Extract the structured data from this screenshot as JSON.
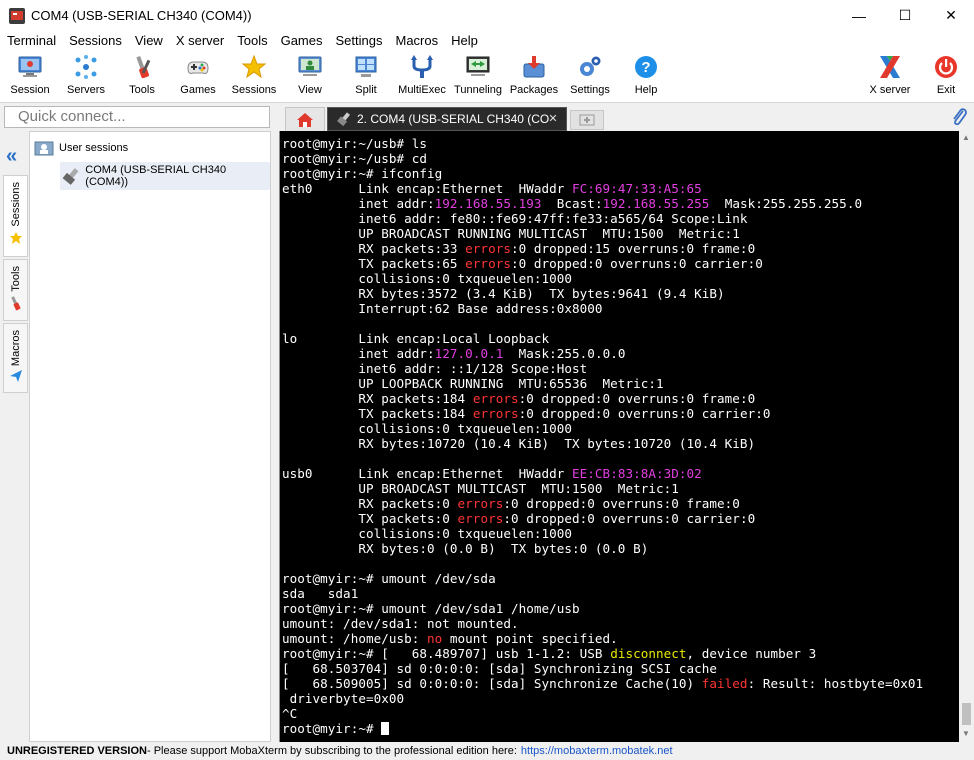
{
  "window": {
    "title": "COM4  (USB-SERIAL CH340 (COM4))",
    "controls": {
      "minimize": "—",
      "maximize": "☐",
      "close": "✕"
    }
  },
  "menu": [
    "Terminal",
    "Sessions",
    "View",
    "X server",
    "Tools",
    "Games",
    "Settings",
    "Macros",
    "Help"
  ],
  "toolbar": {
    "session": "Session",
    "servers": "Servers",
    "tools": "Tools",
    "games": "Games",
    "sessions": "Sessions",
    "view": "View",
    "split": "Split",
    "multiexec": "MultiExec",
    "tunneling": "Tunneling",
    "packages": "Packages",
    "settings": "Settings",
    "help": "Help",
    "xserver": "X server",
    "exit": "Exit"
  },
  "quick_connect": {
    "placeholder": "Quick connect..."
  },
  "tabs": {
    "active_label": "2. COM4  (USB-SERIAL CH340 (CO",
    "close_glyph": "✕"
  },
  "rail": {
    "sessions": "Sessions",
    "tools": "Tools",
    "macros": "Macros"
  },
  "sessions_tree": {
    "root": "User sessions",
    "child": "COM4  (USB-SERIAL CH340 (COM4))"
  },
  "terminal": {
    "lines": [
      "root@myir:~/usb# ls",
      "root@myir:~/usb# cd",
      "root@myir:~# ifconfig",
      "eth0      Link encap:Ethernet  HWaddr FC:69:47:33:A5:65",
      "          inet addr:192.168.55.193  Bcast:192.168.55.255  Mask:255.255.255.0",
      "          inet6 addr: fe80::fe69:47ff:fe33:a565/64 Scope:Link",
      "          UP BROADCAST RUNNING MULTICAST  MTU:1500  Metric:1",
      "          RX packets:33 errors:0 dropped:15 overruns:0 frame:0",
      "          TX packets:65 errors:0 dropped:0 overruns:0 carrier:0",
      "          collisions:0 txqueuelen:1000",
      "          RX bytes:3572 (3.4 KiB)  TX bytes:9641 (9.4 KiB)",
      "          Interrupt:62 Base address:0x8000",
      "",
      "lo        Link encap:Local Loopback",
      "          inet addr:127.0.0.1  Mask:255.0.0.0",
      "          inet6 addr: ::1/128 Scope:Host",
      "          UP LOOPBACK RUNNING  MTU:65536  Metric:1",
      "          RX packets:184 errors:0 dropped:0 overruns:0 frame:0",
      "          TX packets:184 errors:0 dropped:0 overruns:0 carrier:0",
      "          collisions:0 txqueuelen:1000",
      "          RX bytes:10720 (10.4 KiB)  TX bytes:10720 (10.4 KiB)",
      "",
      "usb0      Link encap:Ethernet  HWaddr EE:CB:83:8A:3D:02",
      "          UP BROADCAST MULTICAST  MTU:1500  Metric:1",
      "          RX packets:0 errors:0 dropped:0 overruns:0 frame:0",
      "          TX packets:0 errors:0 dropped:0 overruns:0 carrier:0",
      "          collisions:0 txqueuelen:1000",
      "          RX bytes:0 (0.0 B)  TX bytes:0 (0.0 B)",
      "",
      "root@myir:~# umount /dev/sda",
      "sda   sda1",
      "root@myir:~# umount /dev/sda1 /home/usb",
      "umount: /dev/sda1: not mounted.",
      "umount: /home/usb: no mount point specified.",
      "root@myir:~# [   68.489707] usb 1-1.2: USB disconnect, device number 3",
      "[   68.503704] sd 0:0:0:0: [sda] Synchronizing SCSI cache",
      "[   68.509005] sd 0:0:0:0: [sda] Synchronize Cache(10) failed: Result: hostbyte=0x01",
      " driverbyte=0x00",
      "^C",
      "root@myir:~# "
    ],
    "highlights": [
      {
        "text": "FC:69:47:33:A5:65",
        "color": "#e23fe0"
      },
      {
        "text": "192.168.55.193",
        "color": "#e23fe0"
      },
      {
        "text": "192.168.55.255",
        "color": "#e23fe0"
      },
      {
        "text": "127.0.0.1",
        "color": "#e23fe0"
      },
      {
        "text": "EE:CB:83:8A:3D:02",
        "color": "#e23fe0"
      },
      {
        "text": "errors",
        "color": "#ff3535"
      },
      {
        "text": "no",
        "color": "#ff3535"
      },
      {
        "text": "disconnect",
        "color": "#e8e800"
      },
      {
        "text": "failed",
        "color": "#ff3535"
      }
    ]
  },
  "status": {
    "unregistered": "UNREGISTERED VERSION",
    "message": "  -  Please support MobaXterm by subscribing to the professional edition here:",
    "link": "https://mobaxterm.mobatek.net"
  },
  "colors": {
    "terminal_bg": "#000000",
    "terminal_fg": "#ffffff",
    "accent_blue": "#2a70c8",
    "magenta": "#e23fe0",
    "red": "#ff3535",
    "yellow": "#e8e800"
  }
}
